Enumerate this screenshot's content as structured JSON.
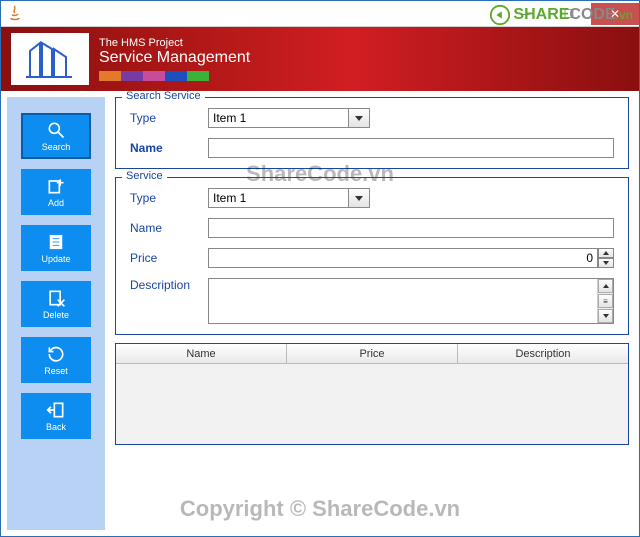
{
  "header": {
    "title1": "The HMS Project",
    "title2": "Service Management",
    "swatches": [
      "#e27a2b",
      "#7a3aa3",
      "#c94b9b",
      "#1f4fbf",
      "#3bb33b",
      "#ffffff",
      "#ffffff",
      "#ffffff"
    ]
  },
  "sidebar": {
    "items": [
      {
        "label": "Search",
        "icon": "search-icon",
        "active": true
      },
      {
        "label": "Add",
        "icon": "add-icon",
        "active": false
      },
      {
        "label": "Update",
        "icon": "update-icon",
        "active": false
      },
      {
        "label": "Delete",
        "icon": "delete-icon",
        "active": false
      },
      {
        "label": "Reset",
        "icon": "reset-icon",
        "active": false
      },
      {
        "label": "Back",
        "icon": "back-icon",
        "active": false
      }
    ]
  },
  "search_section": {
    "legend": "Search Service",
    "type_label": "Type",
    "type_value": "Item 1",
    "name_label": "Name",
    "name_value": ""
  },
  "service_section": {
    "legend": "Service",
    "type_label": "Type",
    "type_value": "Item 1",
    "name_label": "Name",
    "name_value": "",
    "price_label": "Price",
    "price_value": "0",
    "desc_label": "Description",
    "desc_value": ""
  },
  "table": {
    "columns": [
      "Name",
      "Price",
      "Description"
    ],
    "rows": []
  },
  "watermarks": {
    "top": "ShareCode.vn",
    "bottom": "Copyright © ShareCode.vn",
    "badge1": "SHARE",
    "badge2": "CODE",
    "badge3": ".vn"
  }
}
